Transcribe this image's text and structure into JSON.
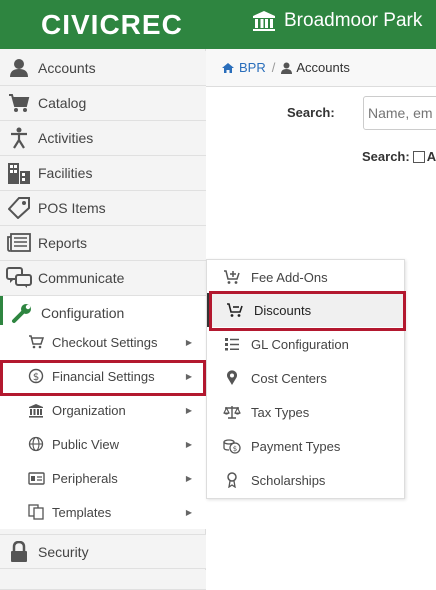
{
  "header": {
    "logo": "CIVICREC",
    "org_name": "Broadmoor Park",
    "brand_color": "#2e8540",
    "highlight_color": "#b3182f"
  },
  "sidebar": {
    "items": [
      {
        "label": "Accounts",
        "icon": "user-icon"
      },
      {
        "label": "Catalog",
        "icon": "cart-icon"
      },
      {
        "label": "Activities",
        "icon": "person-icon"
      },
      {
        "label": "Facilities",
        "icon": "building-icon"
      },
      {
        "label": "POS Items",
        "icon": "tag-icon"
      },
      {
        "label": "Reports",
        "icon": "newspaper-icon"
      },
      {
        "label": "Communicate",
        "icon": "chat-icon"
      },
      {
        "label": "Configuration",
        "icon": "wrench-icon"
      }
    ],
    "config_submenu": [
      {
        "label": "Checkout Settings",
        "icon": "cart-outline-icon"
      },
      {
        "label": "Financial Settings",
        "icon": "dollar-circle-icon"
      },
      {
        "label": "Organization",
        "icon": "bank-icon"
      },
      {
        "label": "Public View",
        "icon": "globe-icon"
      },
      {
        "label": "Peripherals",
        "icon": "id-card-icon"
      },
      {
        "label": "Templates",
        "icon": "copy-icon"
      }
    ],
    "bottom_items": [
      {
        "label": "Security",
        "icon": "lock-icon"
      }
    ]
  },
  "breadcrumb": {
    "home": "BPR",
    "separator": "/",
    "current": "Accounts"
  },
  "search": {
    "label": "Search:",
    "placeholder": "Name, em",
    "label2": "Search:",
    "checkbox_label": "A"
  },
  "flyout": {
    "items": [
      {
        "label": "Fee Add-Ons",
        "icon": "cart-plus-icon"
      },
      {
        "label": "Discounts",
        "icon": "cart-minus-icon"
      },
      {
        "label": "GL Configuration",
        "icon": "list-icon"
      },
      {
        "label": "Cost Centers",
        "icon": "map-pin-icon"
      },
      {
        "label": "Tax Types",
        "icon": "balance-icon"
      },
      {
        "label": "Payment Types",
        "icon": "coins-icon"
      },
      {
        "label": "Scholarships",
        "icon": "award-icon"
      }
    ]
  }
}
